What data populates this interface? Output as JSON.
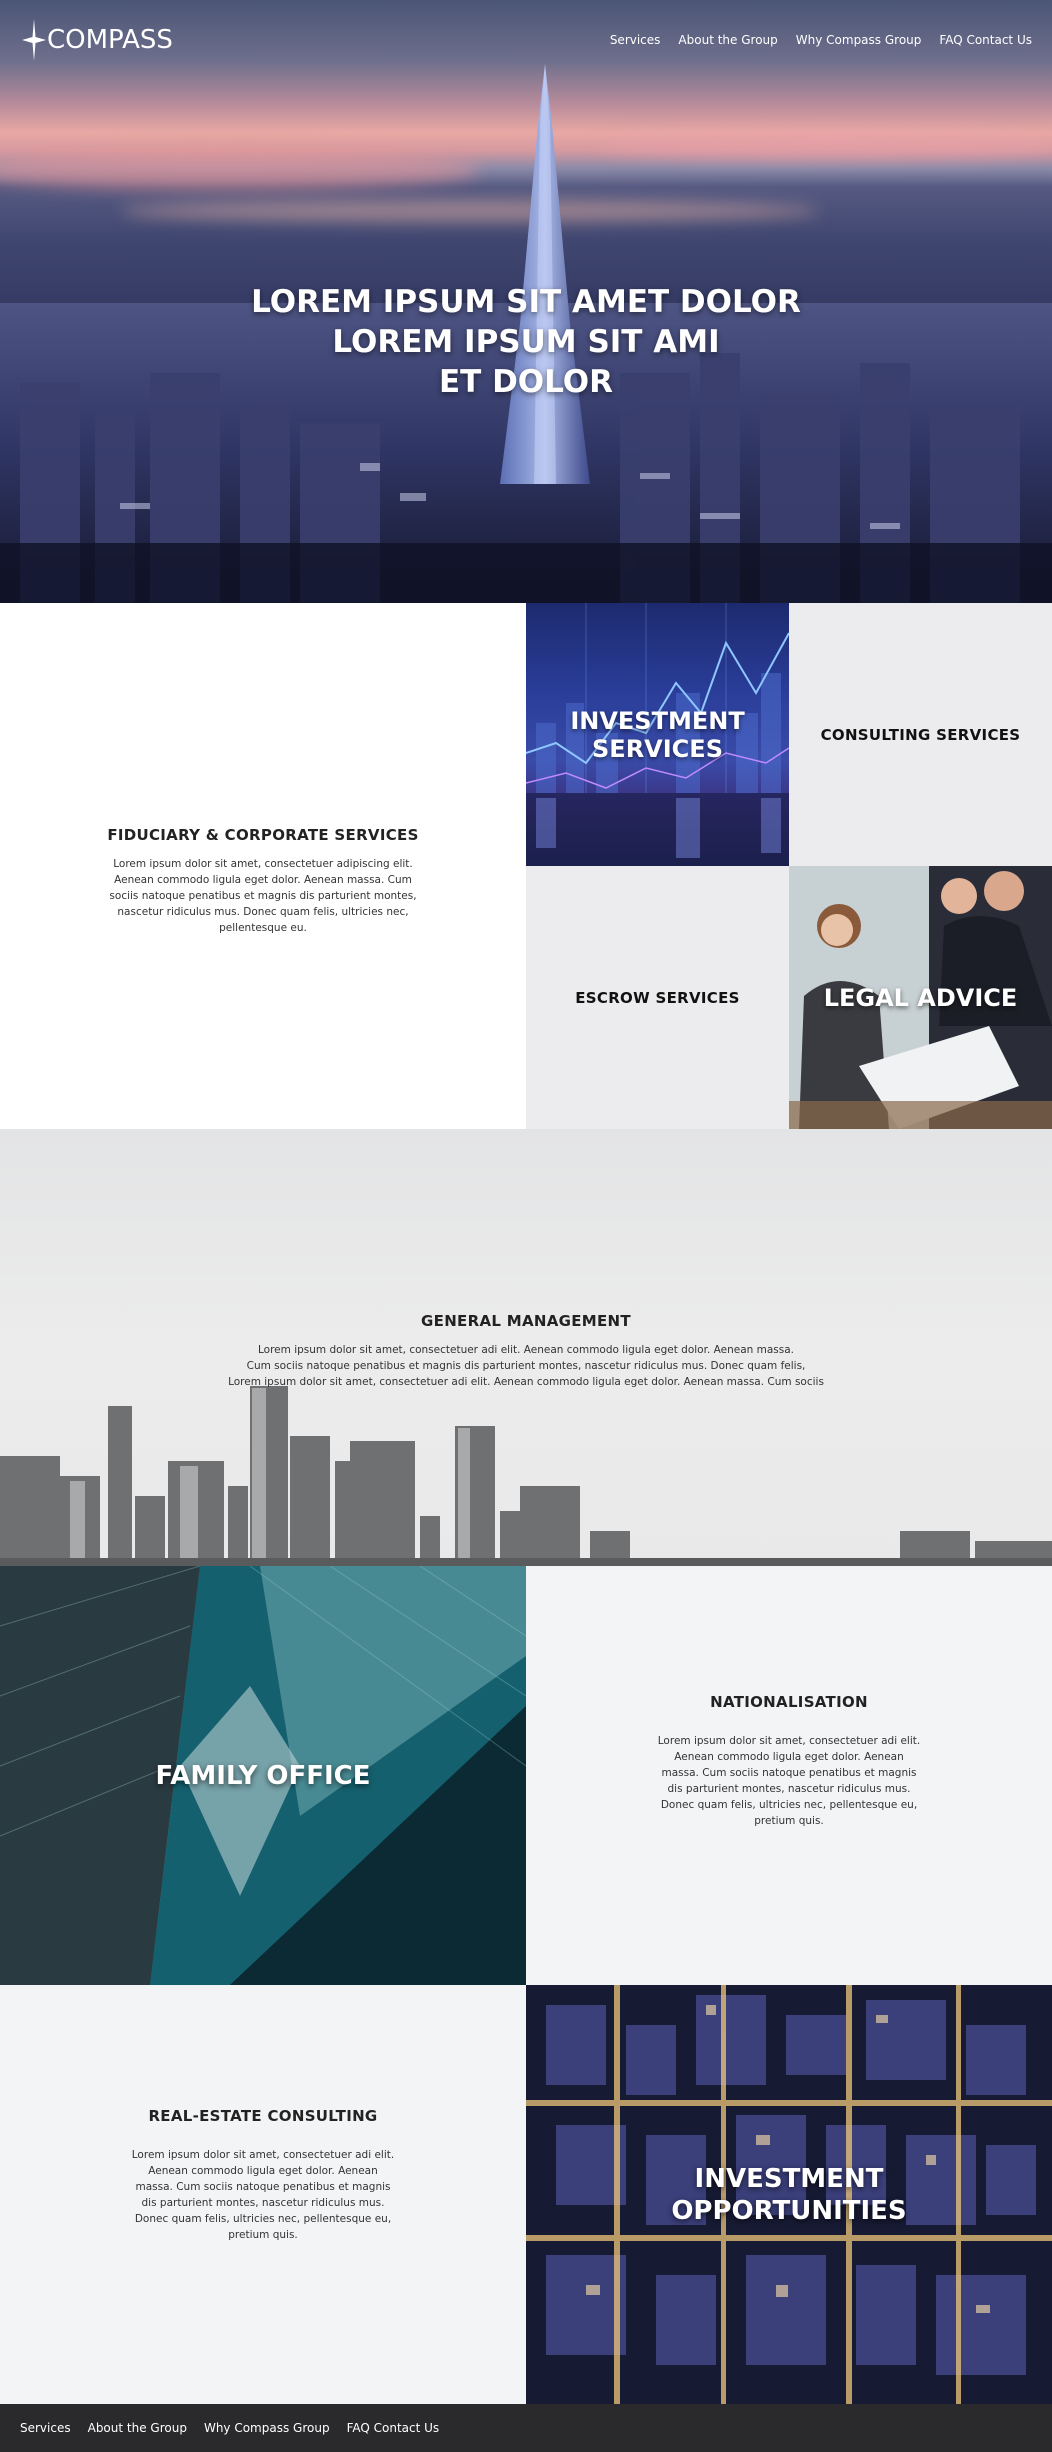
{
  "brand": {
    "logo_text": "COMPASS"
  },
  "nav": {
    "items": [
      {
        "label": "Services"
      },
      {
        "label": "About the Group"
      },
      {
        "label": "Why Compass Group"
      },
      {
        "label": "FAQ Contact Us"
      }
    ]
  },
  "hero": {
    "lines": [
      "LOREM IPSUM SIT AMET DOLOR",
      "LOREM IPSUM SIT AMI",
      "ET DOLOR"
    ]
  },
  "services": {
    "fiduciary": {
      "title": "FIDUCIARY & CORPORATE SERVICES",
      "body": "Lorem ipsum dolor sit amet, consectetuer adipiscing elit. Aenean commodo ligula eget dolor. Aenean massa. Cum sociis natoque penatibus et magnis dis parturient montes, nascetur ridiculus mus. Donec quam felis, ultricies nec, pellentesque eu."
    },
    "investment_services": {
      "line1": "INVESTMENT",
      "line2": "SERVICES"
    },
    "consulting": {
      "title": "CONSULTING SERVICES"
    },
    "escrow": {
      "title": "ESCROW SERVICES"
    },
    "legal": {
      "title": "LEGAL ADVICE"
    }
  },
  "general_management": {
    "title": "GENERAL MANAGEMENT",
    "lines": [
      "Lorem ipsum dolor sit amet, consectetuer adi elit. Aenean commodo ligula eget dolor. Aenean massa.",
      "Cum sociis natoque penatibus et magnis dis parturient montes, nascetur ridiculus mus. Donec quam felis,",
      "Lorem ipsum dolor sit amet, consectetuer adi elit. Aenean commodo ligula eget dolor. Aenean massa. Cum sociis"
    ]
  },
  "family_office": {
    "title": "FAMILY OFFICE"
  },
  "nationalisation": {
    "title": "NATIONALISATION",
    "body": "Lorem ipsum dolor sit amet, consectetuer adi elit. Aenean commodo ligula eget dolor. Aenean massa. Cum sociis natoque penatibus et magnis dis parturient montes, nascetur ridiculus mus. Donec quam felis, ultricies nec, pellentesque eu, pretium quis."
  },
  "real_estate": {
    "title": "REAL-ESTATE CONSULTING",
    "body": "Lorem ipsum dolor sit amet, consectetuer adi elit. Aenean commodo ligula eget dolor. Aenean massa. Cum sociis natoque penatibus et magnis dis parturient montes, nascetur ridiculus mus. Donec quam felis, ultricies nec, pellentesque eu, pretium quis."
  },
  "investment_opportunities": {
    "line1": "INVESTMENT",
    "line2": "OPPORTUNITIES"
  },
  "footer": {
    "items": [
      {
        "label": "Services"
      },
      {
        "label": "About the Group"
      },
      {
        "label": "Why Compass Group"
      },
      {
        "label": "FAQ Contact Us"
      }
    ]
  },
  "colors": {
    "footer_bg": "#2a2a2c",
    "tile_grey": "#ececee",
    "panel_light": "#f3f4f6",
    "text_dark": "#111111"
  }
}
